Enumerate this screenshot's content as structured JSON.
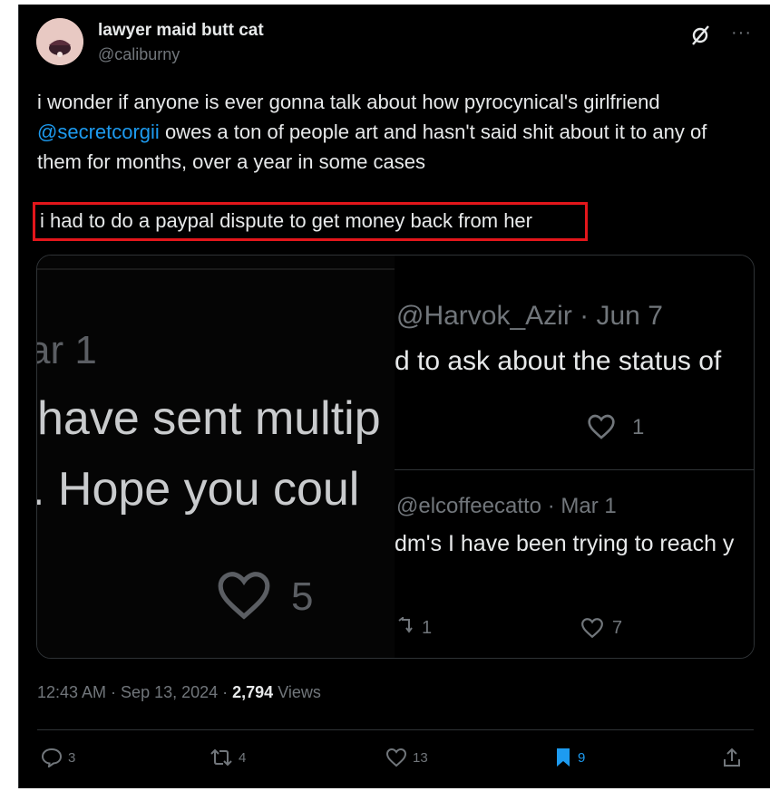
{
  "tweet": {
    "display_name": "lawyer maid butt cat",
    "handle": "@caliburny",
    "text_part1": "i wonder if anyone is ever gonna talk about how pyrocynical's girlfriend",
    "mention": "@secretcorgii",
    "text_part2": " owes a ton of people art and hasn't said shit about it to any of them for months, over a year in some cases",
    "highlighted_line": "i had to do a paypal dispute to get money back from her",
    "timestamp": "12:43 AM · Sep 13, 2024 · ",
    "views_count": "2,794",
    "views_label": " Views"
  },
  "media": {
    "left": {
      "date": "ar 1",
      "line1": "have sent multip",
      "line2": ". Hope you coul",
      "likes": "5"
    },
    "right_top": {
      "header": "@Harvok_Azir · Jun 7",
      "text": "d to ask about the status of",
      "likes": "1"
    },
    "right_bottom": {
      "header": "@elcoffeecatto · Mar 1",
      "text": "dm's I have been trying to reach y",
      "retweets": "1",
      "likes": "7"
    }
  },
  "actions": {
    "replies": "3",
    "reposts": "4",
    "likes": "13",
    "bookmarks": "9"
  },
  "colors": {
    "background": "#000000",
    "text": "#e7e9ea",
    "muted": "#71767b",
    "link": "#1d9bf0",
    "highlight_box": "#e3161b"
  }
}
